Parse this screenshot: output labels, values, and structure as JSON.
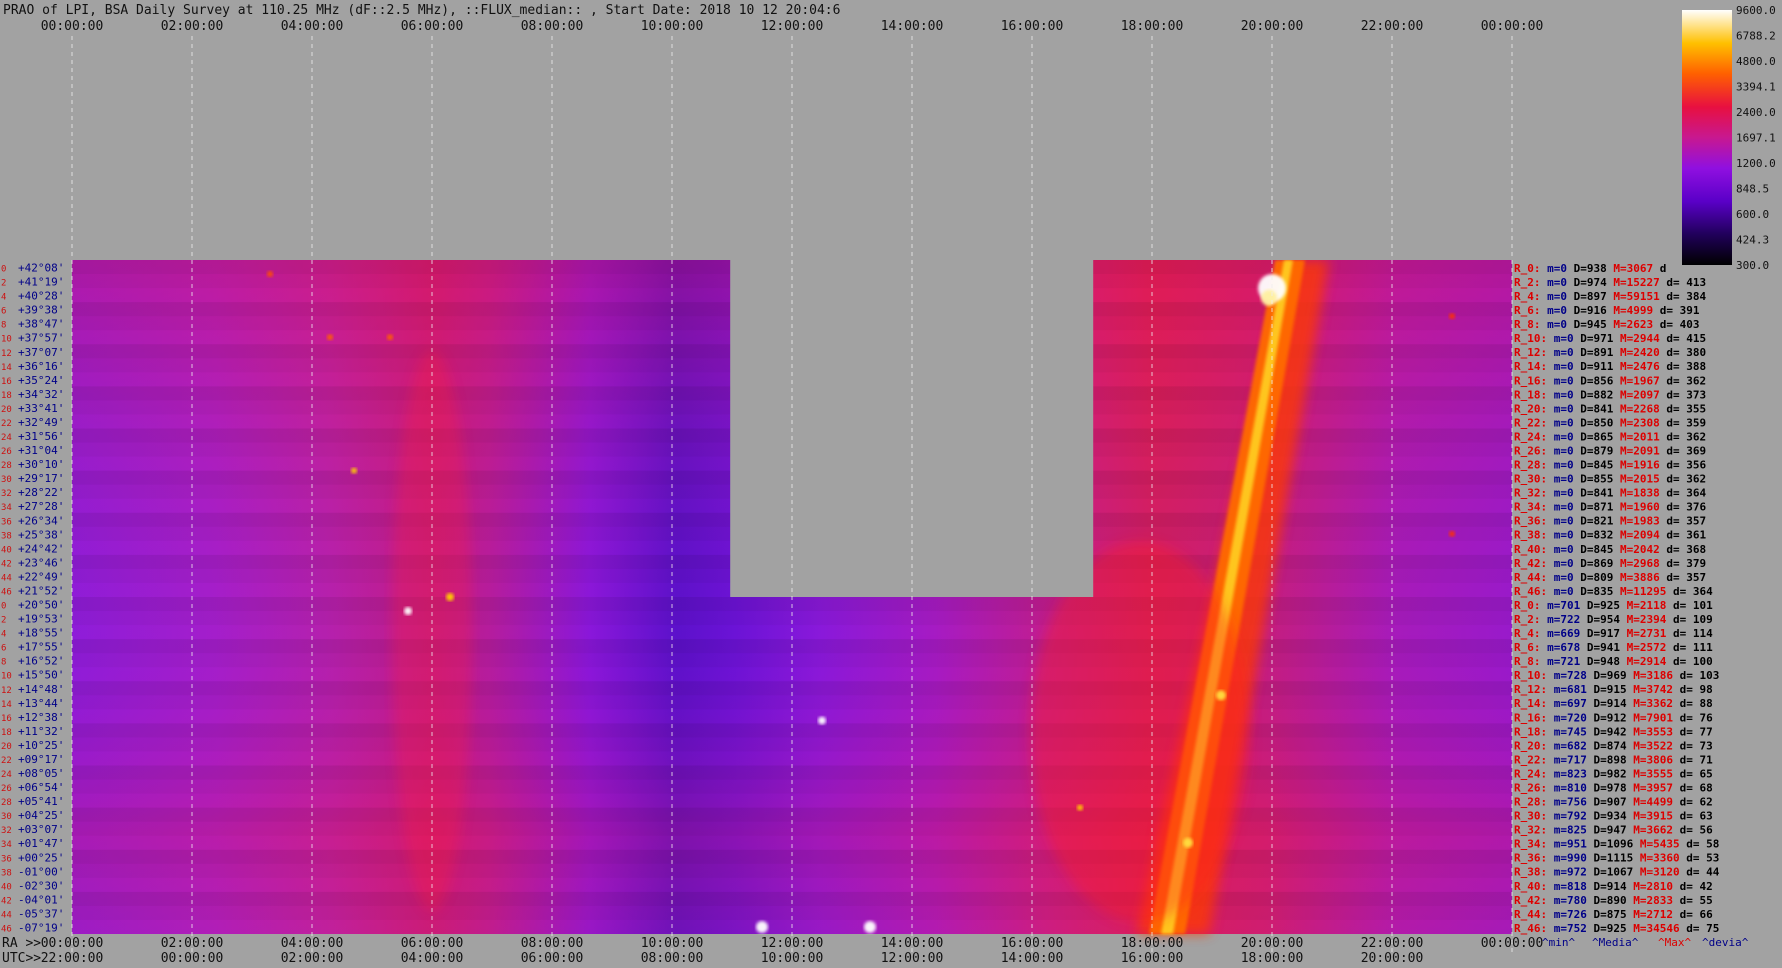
{
  "title": "PRAO of LPI, BSA Daily Survey at 110.25 MHz (dF::2.5 MHz), ::FLUX_median:: , Start Date: 2018 10 12 20:04:6",
  "colors": {
    "background": "#a2a2a2",
    "axis_text": "#111111",
    "row_label": "#cc1111",
    "stat_blue": "#000088",
    "stat_red": "#dd0000",
    "grid": "#eeeeee"
  },
  "chart_data": {
    "type": "heatmap",
    "x_axis_top": {
      "labels": [
        "00:00:00",
        "02:00:00",
        "04:00:00",
        "06:00:00",
        "08:00:00",
        "10:00:00",
        "12:00:00",
        "14:00:00",
        "16:00:00",
        "18:00:00",
        "20:00:00",
        "22:00:00",
        "00:00:00"
      ],
      "range_hours": [
        0,
        24
      ]
    },
    "x_axis_bottom_ra": {
      "prefix": "RA >>",
      "labels": [
        "00:00:00",
        "02:00:00",
        "04:00:00",
        "06:00:00",
        "08:00:00",
        "10:00:00",
        "12:00:00",
        "14:00:00",
        "16:00:00",
        "18:00:00",
        "20:00:00",
        "22:00:00",
        "00:00:00"
      ]
    },
    "x_axis_bottom_utc": {
      "prefix": "UTC>>",
      "labels": [
        "22:00:00",
        "00:00:00",
        "02:00:00",
        "04:00:00",
        "06:00:00",
        "08:00:00",
        "10:00:00",
        "12:00:00",
        "14:00:00",
        "16:00:00",
        "18:00:00",
        "20:00:00"
      ]
    },
    "grid": true,
    "colorbar": {
      "ticks": [
        "9600.0",
        "6788.2",
        "4800.0",
        "3394.1",
        "2400.0",
        "1697.1",
        "1200.0",
        "848.5",
        "600.0",
        "424.3",
        "300.0"
      ],
      "range": [
        300,
        9600
      ],
      "scale": "log"
    },
    "masked_ra_hours": [
      {
        "from": 10.97,
        "to": 17.02,
        "rows": [
          0,
          23
        ]
      }
    ],
    "rows": [
      {
        "idx": "0",
        "dec": "+42°08'",
        "stat": {
          "r": "R_0:",
          "m": "m=0",
          "d": "D=938",
          "mx": "M=3067",
          "dv": "d"
        }
      },
      {
        "idx": "2",
        "dec": "+41°19'",
        "stat": {
          "r": "R_2:",
          "m": "m=0",
          "d": "D=974",
          "mx": "M=15227",
          "dv": "d= 413"
        }
      },
      {
        "idx": "4",
        "dec": "+40°28'",
        "stat": {
          "r": "R_4:",
          "m": "m=0",
          "d": "D=897",
          "mx": "M=59151",
          "dv": "d= 384"
        }
      },
      {
        "idx": "6",
        "dec": "+39°38'",
        "stat": {
          "r": "R_6:",
          "m": "m=0",
          "d": "D=916",
          "mx": "M=4999",
          "dv": "d= 391"
        }
      },
      {
        "idx": "8",
        "dec": "+38°47'",
        "stat": {
          "r": "R_8:",
          "m": "m=0",
          "d": "D=945",
          "mx": "M=2623",
          "dv": "d= 403"
        }
      },
      {
        "idx": "10",
        "dec": "+37°57'",
        "stat": {
          "r": "R_10:",
          "m": "m=0",
          "d": "D=971",
          "mx": "M=2944",
          "dv": "d= 415"
        }
      },
      {
        "idx": "12",
        "dec": "+37°07'",
        "stat": {
          "r": "R_12:",
          "m": "m=0",
          "d": "D=891",
          "mx": "M=2420",
          "dv": "d= 380"
        }
      },
      {
        "idx": "14",
        "dec": "+36°16'",
        "stat": {
          "r": "R_14:",
          "m": "m=0",
          "d": "D=911",
          "mx": "M=2476",
          "dv": "d= 388"
        }
      },
      {
        "idx": "16",
        "dec": "+35°24'",
        "stat": {
          "r": "R_16:",
          "m": "m=0",
          "d": "D=856",
          "mx": "M=1967",
          "dv": "d= 362"
        }
      },
      {
        "idx": "18",
        "dec": "+34°32'",
        "stat": {
          "r": "R_18:",
          "m": "m=0",
          "d": "D=882",
          "mx": "M=2097",
          "dv": "d= 373"
        }
      },
      {
        "idx": "20",
        "dec": "+33°41'",
        "stat": {
          "r": "R_20:",
          "m": "m=0",
          "d": "D=841",
          "mx": "M=2268",
          "dv": "d= 355"
        }
      },
      {
        "idx": "22",
        "dec": "+32°49'",
        "stat": {
          "r": "R_22:",
          "m": "m=0",
          "d": "D=850",
          "mx": "M=2308",
          "dv": "d= 359"
        }
      },
      {
        "idx": "24",
        "dec": "+31°56'",
        "stat": {
          "r": "R_24:",
          "m": "m=0",
          "d": "D=865",
          "mx": "M=2011",
          "dv": "d= 362"
        }
      },
      {
        "idx": "26",
        "dec": "+31°04'",
        "stat": {
          "r": "R_26:",
          "m": "m=0",
          "d": "D=879",
          "mx": "M=2091",
          "dv": "d= 369"
        }
      },
      {
        "idx": "28",
        "dec": "+30°10'",
        "stat": {
          "r": "R_28:",
          "m": "m=0",
          "d": "D=845",
          "mx": "M=1916",
          "dv": "d= 356"
        }
      },
      {
        "idx": "30",
        "dec": "+29°17'",
        "stat": {
          "r": "R_30:",
          "m": "m=0",
          "d": "D=855",
          "mx": "M=2015",
          "dv": "d= 362"
        }
      },
      {
        "idx": "32",
        "dec": "+28°22'",
        "stat": {
          "r": "R_32:",
          "m": "m=0",
          "d": "D=841",
          "mx": "M=1838",
          "dv": "d= 364"
        }
      },
      {
        "idx": "34",
        "dec": "+27°28'",
        "stat": {
          "r": "R_34:",
          "m": "m=0",
          "d": "D=871",
          "mx": "M=1960",
          "dv": "d= 376"
        }
      },
      {
        "idx": "36",
        "dec": "+26°34'",
        "stat": {
          "r": "R_36:",
          "m": "m=0",
          "d": "D=821",
          "mx": "M=1983",
          "dv": "d= 357"
        }
      },
      {
        "idx": "38",
        "dec": "+25°38'",
        "stat": {
          "r": "R_38:",
          "m": "m=0",
          "d": "D=832",
          "mx": "M=2094",
          "dv": "d= 361"
        }
      },
      {
        "idx": "40",
        "dec": "+24°42'",
        "stat": {
          "r": "R_40:",
          "m": "m=0",
          "d": "D=845",
          "mx": "M=2042",
          "dv": "d= 368"
        }
      },
      {
        "idx": "42",
        "dec": "+23°46'",
        "stat": {
          "r": "R_42:",
          "m": "m=0",
          "d": "D=869",
          "mx": "M=2968",
          "dv": "d= 379"
        }
      },
      {
        "idx": "44",
        "dec": "+22°49'",
        "stat": {
          "r": "R_44:",
          "m": "m=0",
          "d": "D=809",
          "mx": "M=3886",
          "dv": "d= 357"
        }
      },
      {
        "idx": "46",
        "dec": "+21°52'",
        "stat": {
          "r": "R_46:",
          "m": "m=0",
          "d": "D=835",
          "mx": "M=11295",
          "dv": "d= 364"
        }
      },
      {
        "idx": "0",
        "dec": "+20°50'",
        "stat": {
          "r": "R_0:",
          "m": "m=701",
          "d": "D=925",
          "mx": "M=2118",
          "dv": "d= 101"
        }
      },
      {
        "idx": "2",
        "dec": "+19°53'",
        "stat": {
          "r": "R_2:",
          "m": "m=722",
          "d": "D=954",
          "mx": "M=2394",
          "dv": "d= 109"
        }
      },
      {
        "idx": "4",
        "dec": "+18°55'",
        "stat": {
          "r": "R_4:",
          "m": "m=669",
          "d": "D=917",
          "mx": "M=2731",
          "dv": "d= 114"
        }
      },
      {
        "idx": "6",
        "dec": "+17°55'",
        "stat": {
          "r": "R_6:",
          "m": "m=678",
          "d": "D=941",
          "mx": "M=2572",
          "dv": "d= 111"
        }
      },
      {
        "idx": "8",
        "dec": "+16°52'",
        "stat": {
          "r": "R_8:",
          "m": "m=721",
          "d": "D=948",
          "mx": "M=2914",
          "dv": "d= 100"
        }
      },
      {
        "idx": "10",
        "dec": "+15°50'",
        "stat": {
          "r": "R_10:",
          "m": "m=728",
          "d": "D=969",
          "mx": "M=3186",
          "dv": "d= 103"
        }
      },
      {
        "idx": "12",
        "dec": "+14°48'",
        "stat": {
          "r": "R_12:",
          "m": "m=681",
          "d": "D=915",
          "mx": "M=3742",
          "dv": "d= 98"
        }
      },
      {
        "idx": "14",
        "dec": "+13°44'",
        "stat": {
          "r": "R_14:",
          "m": "m=697",
          "d": "D=914",
          "mx": "M=3362",
          "dv": "d= 88"
        }
      },
      {
        "idx": "16",
        "dec": "+12°38'",
        "stat": {
          "r": "R_16:",
          "m": "m=720",
          "d": "D=912",
          "mx": "M=7901",
          "dv": "d= 76"
        }
      },
      {
        "idx": "18",
        "dec": "+11°32'",
        "stat": {
          "r": "R_18:",
          "m": "m=745",
          "d": "D=942",
          "mx": "M=3553",
          "dv": "d= 77"
        }
      },
      {
        "idx": "20",
        "dec": "+10°25'",
        "stat": {
          "r": "R_20:",
          "m": "m=682",
          "d": "D=874",
          "mx": "M=3522",
          "dv": "d= 73"
        }
      },
      {
        "idx": "22",
        "dec": "+09°17'",
        "stat": {
          "r": "R_22:",
          "m": "m=717",
          "d": "D=898",
          "mx": "M=3806",
          "dv": "d= 71"
        }
      },
      {
        "idx": "24",
        "dec": "+08°05'",
        "stat": {
          "r": "R_24:",
          "m": "m=823",
          "d": "D=982",
          "mx": "M=3555",
          "dv": "d= 65"
        }
      },
      {
        "idx": "26",
        "dec": "+06°54'",
        "stat": {
          "r": "R_26:",
          "m": "m=810",
          "d": "D=978",
          "mx": "M=3957",
          "dv": "d= 68"
        }
      },
      {
        "idx": "28",
        "dec": "+05°41'",
        "stat": {
          "r": "R_28:",
          "m": "m=756",
          "d": "D=907",
          "mx": "M=4499",
          "dv": "d= 62"
        }
      },
      {
        "idx": "30",
        "dec": "+04°25'",
        "stat": {
          "r": "R_30:",
          "m": "m=792",
          "d": "D=934",
          "mx": "M=3915",
          "dv": "d= 63"
        }
      },
      {
        "idx": "32",
        "dec": "+03°07'",
        "stat": {
          "r": "R_32:",
          "m": "m=825",
          "d": "D=947",
          "mx": "M=3662",
          "dv": "d= 56"
        }
      },
      {
        "idx": "34",
        "dec": "+01°47'",
        "stat": {
          "r": "R_34:",
          "m": "m=951",
          "d": "D=1096",
          "mx": "M=5435",
          "dv": "d= 58"
        }
      },
      {
        "idx": "36",
        "dec": "+00°25'",
        "stat": {
          "r": "R_36:",
          "m": "m=990",
          "d": "D=1115",
          "mx": "M=3360",
          "dv": "d= 53"
        }
      },
      {
        "idx": "38",
        "dec": "-01°00'",
        "stat": {
          "r": "R_38:",
          "m": "m=972",
          "d": "D=1067",
          "mx": "M=3120",
          "dv": "d= 44"
        }
      },
      {
        "idx": "40",
        "dec": "-02°30'",
        "stat": {
          "r": "R_40:",
          "m": "m=818",
          "d": "D=914",
          "mx": "M=2810",
          "dv": "d= 42"
        }
      },
      {
        "idx": "42",
        "dec": "-04°01'",
        "stat": {
          "r": "R_42:",
          "m": "m=780",
          "d": "D=890",
          "mx": "M=2833",
          "dv": "d= 55"
        }
      },
      {
        "idx": "44",
        "dec": "-05°37'",
        "stat": {
          "r": "R_44:",
          "m": "m=726",
          "d": "D=875",
          "mx": "M=2712",
          "dv": "d= 66"
        }
      },
      {
        "idx": "46",
        "dec": "-07°19'",
        "stat": {
          "r": "R_46:",
          "m": "m=752",
          "d": "D=925",
          "mx": "M=34546",
          "dv": "d= 75"
        }
      }
    ],
    "footer_legend": [
      "^min^",
      "^Media^",
      "^Max^",
      "^devia^"
    ]
  }
}
